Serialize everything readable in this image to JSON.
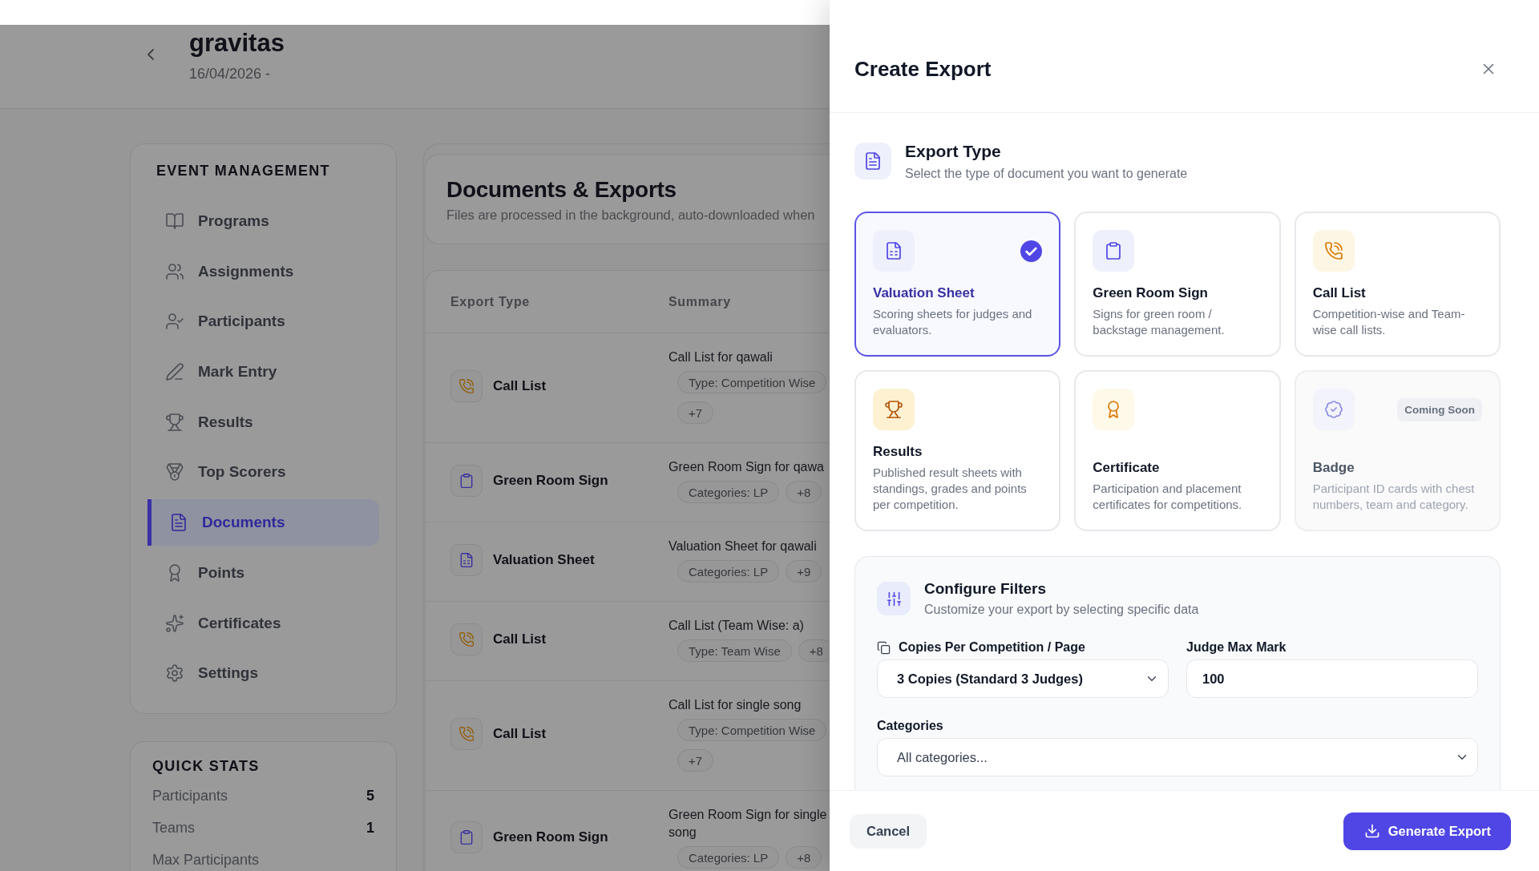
{
  "page_header": {
    "title": "gravitas",
    "date": "16/04/2026 -"
  },
  "sidebar": {
    "heading": "EVENT MANAGEMENT",
    "items": [
      {
        "label": "Programs",
        "selected": false
      },
      {
        "label": "Assignments",
        "selected": false
      },
      {
        "label": "Participants",
        "selected": false
      },
      {
        "label": "Mark Entry",
        "selected": false
      },
      {
        "label": "Results",
        "selected": false
      },
      {
        "label": "Top Scorers",
        "selected": false
      },
      {
        "label": "Documents",
        "selected": true
      },
      {
        "label": "Points",
        "selected": false
      },
      {
        "label": "Certificates",
        "selected": false
      },
      {
        "label": "Settings",
        "selected": false
      }
    ]
  },
  "quick_stats": {
    "heading": "QUICK STATS",
    "rows": [
      {
        "label": "Participants",
        "value": "5"
      },
      {
        "label": "Teams",
        "value": "1"
      },
      {
        "label": "Max Participants"
      }
    ]
  },
  "documents": {
    "title": "Documents & Exports",
    "subtitle": "Files are processed in the background, auto-downloaded when"
  },
  "table": {
    "columns": [
      "Export Type",
      "Summary"
    ],
    "rows": [
      {
        "kind": "calllist",
        "export_type": "Call List",
        "summary": "Call List for qawali",
        "tags": [
          "Type: Competition Wise",
          "+7"
        ]
      },
      {
        "kind": "greenroom",
        "export_type": "Green Room Sign",
        "summary": "Green Room Sign for qawa",
        "tags": [
          "Categories: LP",
          "+8"
        ]
      },
      {
        "kind": "valuation",
        "export_type": "Valuation Sheet",
        "summary": "Valuation Sheet for qawali",
        "tags": [
          "Categories: LP",
          "+9"
        ]
      },
      {
        "kind": "calllist",
        "export_type": "Call List",
        "summary": "Call List (Team Wise: a)",
        "tags": [
          "Type: Team Wise",
          "+8"
        ]
      },
      {
        "kind": "calllist",
        "export_type": "Call List",
        "summary": "Call List for single song",
        "tags": [
          "Type: Competition Wise",
          "+7"
        ]
      },
      {
        "kind": "greenroom",
        "export_type": "Green Room Sign",
        "summary": "Green Room Sign for single song",
        "tags": [
          "Categories: LP",
          "+8"
        ]
      }
    ]
  },
  "export_panel": {
    "title": "Create Export",
    "export_type": {
      "title": "Export Type",
      "subtitle": "Select the type of document you want to generate",
      "options": [
        {
          "kind": "valuation",
          "title": "Valuation Sheet",
          "description": "Scoring sheets for judges and evaluators.",
          "selected": true,
          "disabled": false
        },
        {
          "kind": "greenroom",
          "title": "Green Room Sign",
          "description": "Signs for green room / backstage management.",
          "selected": false,
          "disabled": false
        },
        {
          "kind": "calllist",
          "title": "Call List",
          "description": "Competition-wise and Team-wise call lists.",
          "selected": false,
          "disabled": false
        },
        {
          "kind": "results",
          "title": "Results",
          "description": "Published result sheets with standings, grades and points per competition.",
          "selected": false,
          "disabled": false
        },
        {
          "kind": "certificate",
          "title": "Certificate",
          "description": "Participation and placement certificates for competitions.",
          "selected": false,
          "disabled": false
        },
        {
          "kind": "badge",
          "title": "Badge",
          "description": "Participant ID cards with chest numbers, team and category.",
          "selected": false,
          "disabled": true,
          "tag": "Coming Soon"
        }
      ]
    },
    "filters": {
      "title": "Configure Filters",
      "subtitle": "Customize your export by selecting specific data",
      "copies": {
        "label": "Copies Per Competition / Page",
        "value": "3 Copies (Standard 3 Judges)"
      },
      "max_mark": {
        "label": "Judge Max Mark",
        "value": "100"
      },
      "categories": {
        "label": "Categories",
        "placeholder": "All categories..."
      }
    },
    "actions": {
      "cancel": "Cancel",
      "generate": "Generate Export"
    }
  }
}
